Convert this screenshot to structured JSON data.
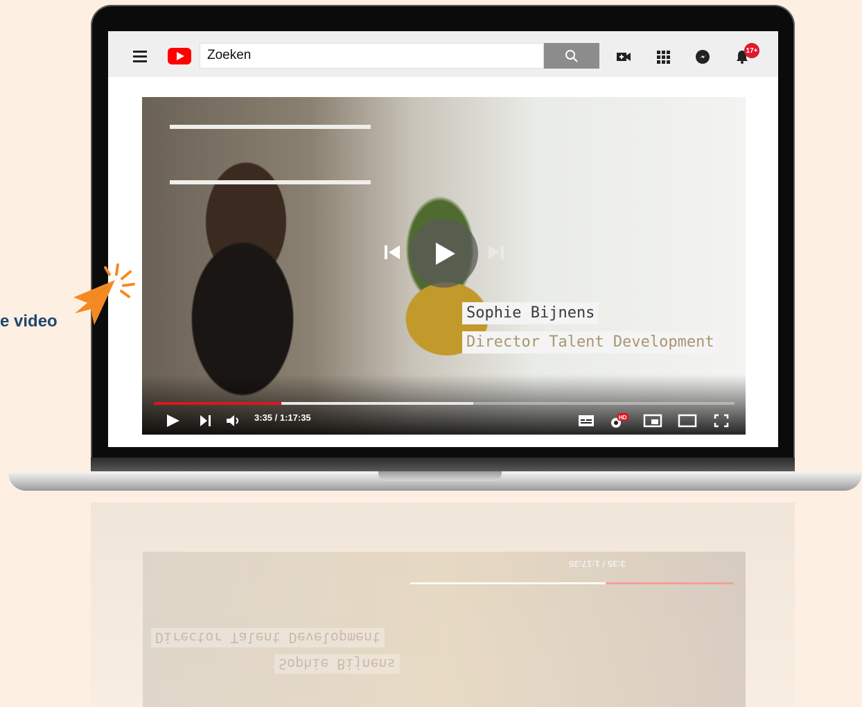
{
  "search": {
    "placeholder": "Zoeken"
  },
  "header": {
    "notification_badge": "17+"
  },
  "video": {
    "person_name": "Sophie Bijnens",
    "person_title": "Director Talent Development",
    "time_display": "3:35 / 1:17:35",
    "progress_played": 0.22,
    "progress_buffered": 0.55
  },
  "cta": {
    "text": "e video"
  },
  "colors": {
    "accent": "#ff0000",
    "progress": "#e0141e",
    "cta": "#1f4770",
    "arrow": "#f58a23"
  }
}
